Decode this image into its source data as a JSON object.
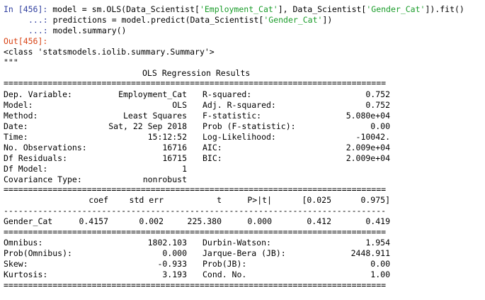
{
  "cell": {
    "in_label": "In [456]:",
    "code_line1_a": " model = sm.OLS(Data_Scientist[",
    "code_line1_s1": "'Employment_Cat'",
    "code_line1_b": "], Data_Scientist[",
    "code_line1_s2": "'Gender_Cat'",
    "code_line1_c": "]).fit()",
    "cont_label": "...:",
    "code_line2_a": " predictions = model.predict(Data_Scientist[",
    "code_line2_s": "'Gender_Cat'",
    "code_line2_b": "])",
    "code_line3": " model.summary()",
    "out_label": "Out[456]:",
    "out_class": "<class 'statsmodels.iolib.summary.Summary'>",
    "out_quotes": "\"\"\""
  },
  "summary": {
    "title": "OLS Regression Results",
    "sep_eq": "==============================================================================",
    "sep_dash": "------------------------------------------------------------------------------",
    "top_rows": [
      {
        "l": "Dep. Variable:",
        "lv": "Employment_Cat",
        "r": "R-squared:",
        "rv": "0.752"
      },
      {
        "l": "Model:",
        "lv": "OLS",
        "r": "Adj. R-squared:",
        "rv": "0.752"
      },
      {
        "l": "Method:",
        "lv": "Least Squares",
        "r": "F-statistic:",
        "rv": "5.080e+04"
      },
      {
        "l": "Date:",
        "lv": "Sat, 22 Sep 2018",
        "r": "Prob (F-statistic):",
        "rv": "0.00"
      },
      {
        "l": "Time:",
        "lv": "15:12:52",
        "r": "Log-Likelihood:",
        "rv": "-10042."
      },
      {
        "l": "No. Observations:",
        "lv": "16716",
        "r": "AIC:",
        "rv": "2.009e+04"
      },
      {
        "l": "Df Residuals:",
        "lv": "16715",
        "r": "BIC:",
        "rv": "2.009e+04"
      },
      {
        "l": "Df Model:",
        "lv": "1",
        "r": "",
        "rv": ""
      },
      {
        "l": "Covariance Type:",
        "lv": "nonrobust",
        "r": "",
        "rv": ""
      }
    ],
    "coef_headers": [
      "coef",
      "std err",
      "t",
      "P>|t|",
      "[0.025",
      "0.975]"
    ],
    "coef_row": {
      "name": "Gender_Cat",
      "values": [
        "0.4157",
        "0.002",
        "225.380",
        "0.000",
        "0.412",
        "0.419"
      ]
    },
    "bottom_rows": [
      {
        "l": "Omnibus:",
        "lv": "1802.103",
        "r": "Durbin-Watson:",
        "rv": "1.954"
      },
      {
        "l": "Prob(Omnibus):",
        "lv": "0.000",
        "r": "Jarque-Bera (JB):",
        "rv": "2448.911"
      },
      {
        "l": "Skew:",
        "lv": "-0.933",
        "r": "Prob(JB):",
        "rv": "0.00"
      },
      {
        "l": "Kurtosis:",
        "lv": "3.193",
        "r": "Cond. No.",
        "rv": "1.00"
      }
    ]
  }
}
